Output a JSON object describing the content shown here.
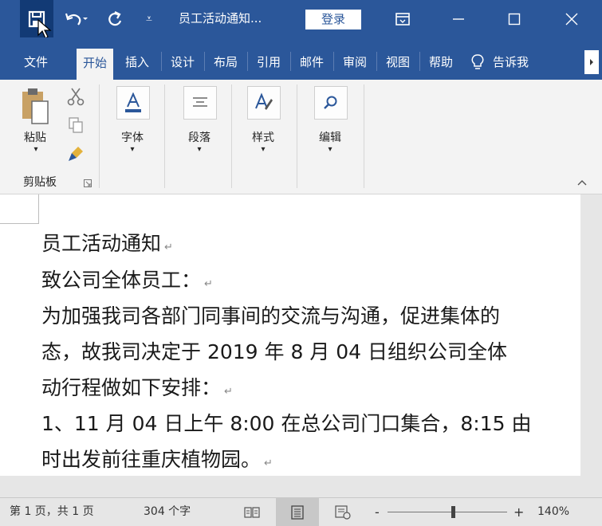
{
  "titlebar": {
    "save_icon": "save-icon",
    "undo_icon": "undo-icon",
    "redo_icon": "redo-icon",
    "customize_icon": "customize-qat-icon",
    "doc_title": "员工活动通知...",
    "login_label": "登录",
    "ribbon_display_icon": "ribbon-display-icon",
    "minimize_icon": "minimize-icon",
    "maximize_icon": "maximize-icon",
    "close_icon": "close-icon"
  },
  "tabs": [
    "文件",
    "开始",
    "插入",
    "设计",
    "布局",
    "引用",
    "邮件",
    "审阅",
    "视图",
    "帮助"
  ],
  "tell_me": "告诉我",
  "ribbon": {
    "paste_label": "粘贴",
    "font_label": "字体",
    "paragraph_label": "段落",
    "styles_label": "样式",
    "editing_label": "编辑",
    "clipboard_group_label": "剪贴板"
  },
  "document": {
    "lines": [
      "员工活动通知",
      "致公司全体员工：",
      "为加强我司各部门同事间的交流与沟通，促进集体的",
      "态，故我司决定于 2019 年 8 月 04 日组织公司全体",
      "动行程做如下安排：",
      "1、11 月 04 日上午 8:00 在总公司门口集合，8:15 由",
      "时出发前往重庆植物园。"
    ],
    "paragraph_mark": "↵"
  },
  "status": {
    "page": "第 1 页，共 1 页",
    "words": "304 个字",
    "zoom_minus": "-",
    "zoom_plus": "+",
    "zoom": "140%",
    "zoom_level_percent": 140
  },
  "colors": {
    "accent": "#2b579a",
    "save_highlight": "#123a75"
  }
}
